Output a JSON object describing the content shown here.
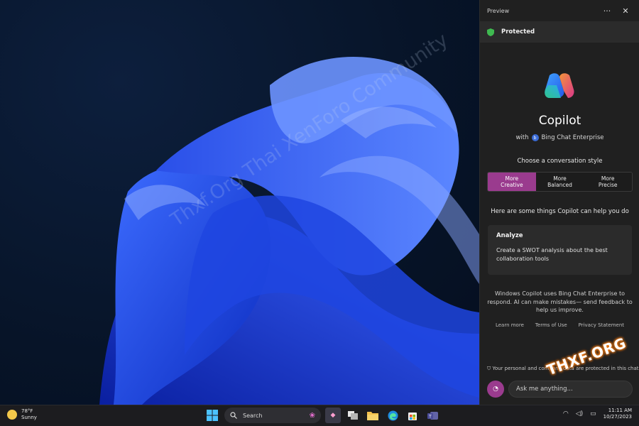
{
  "panel": {
    "title": "Preview",
    "more_label": "···",
    "close_label": "✕",
    "protected_label": "Protected",
    "app_name": "Copilot",
    "with_prefix": "with",
    "enterprise_label": "Bing Chat Enterprise",
    "style_heading": "Choose a conversation style",
    "styles": [
      {
        "line1": "More",
        "line2": "Creative",
        "active": true
      },
      {
        "line1": "More",
        "line2": "Balanced",
        "active": false
      },
      {
        "line1": "More",
        "line2": "Precise",
        "active": false
      }
    ],
    "help_text": "Here are some things Copilot can help you do",
    "card": {
      "title": "Analyze",
      "body": "Create a SWOT analysis about the best collaboration tools"
    },
    "disclaimer": "Windows Copilot uses Bing Chat Enterprise to respond. AI can make mistakes— send feedback to help us improve.",
    "links": [
      "Learn more",
      "Terms of Use",
      "Privacy Statement"
    ],
    "privacy_note": "Your personal and company data are protected in this chat",
    "chat_placeholder": "Ask me anything..."
  },
  "watermark": "Thxf.Org Thai XenForo Community",
  "badge": "THXF.ORG",
  "taskbar": {
    "weather_temp": "78°F",
    "weather_desc": "Sunny",
    "search_label": "Search",
    "time": "11:11 AM",
    "date": "10/27/2023"
  },
  "colors": {
    "accent": "#9a3b8e",
    "panel_bg": "#202020",
    "protected_green": "#3fb950"
  }
}
